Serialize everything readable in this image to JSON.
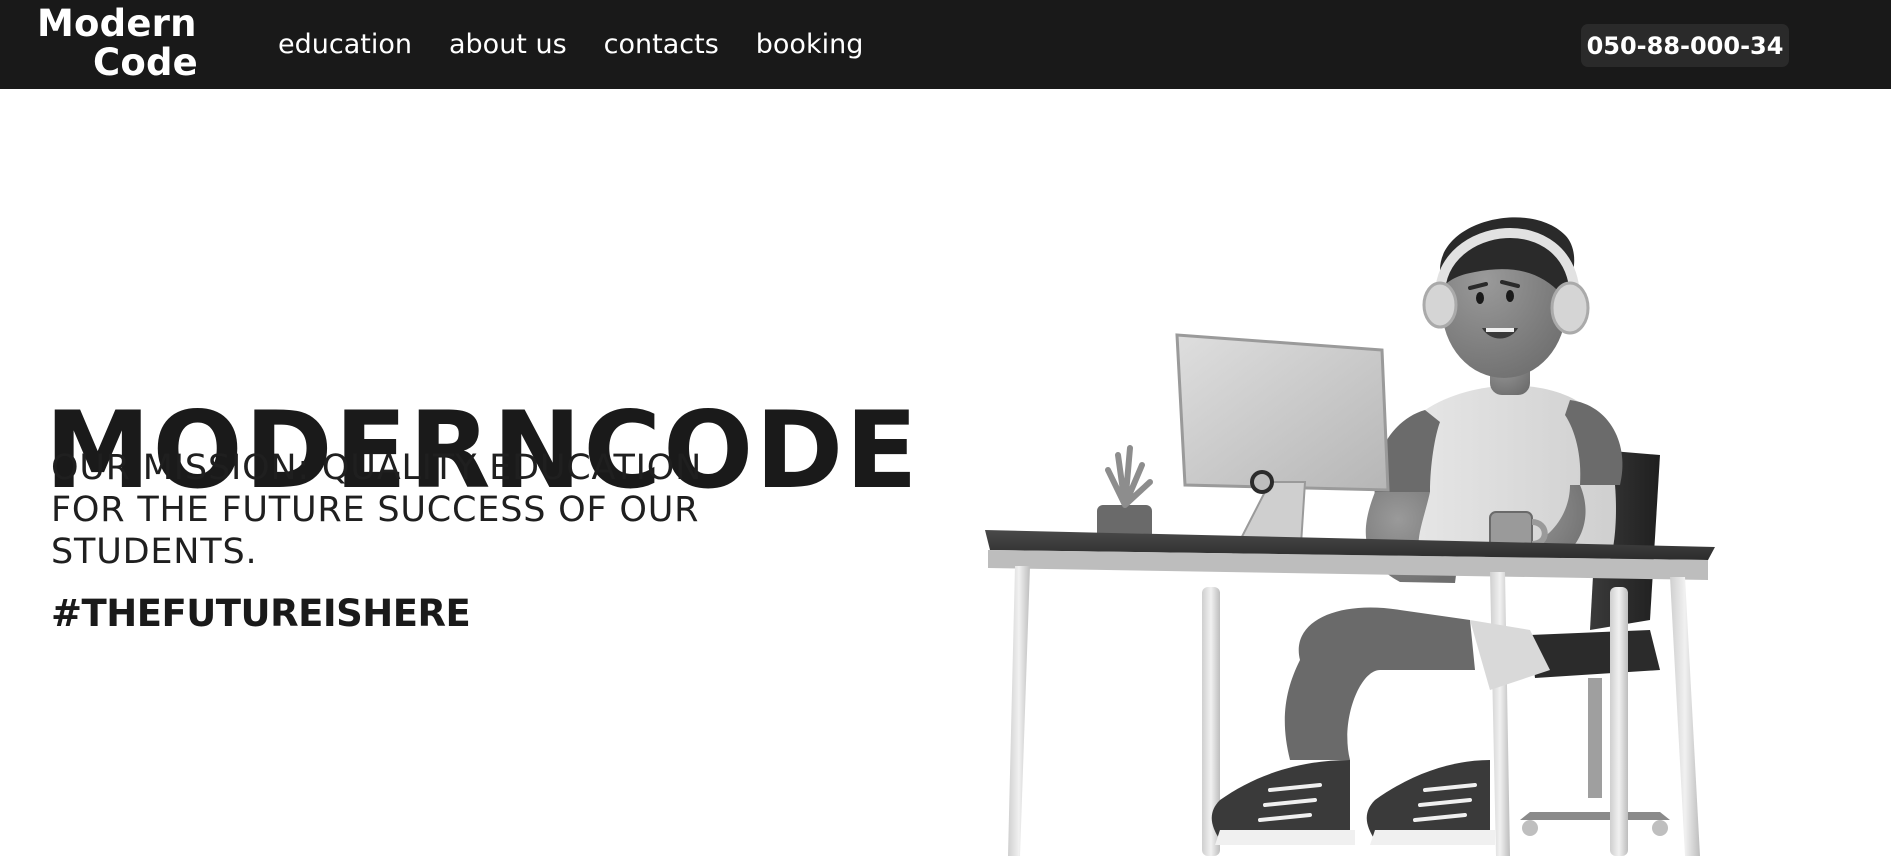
{
  "header": {
    "logo": {
      "line1": "Modern",
      "line2": "Code"
    },
    "nav": [
      {
        "label": "education"
      },
      {
        "label": "about us"
      },
      {
        "label": "contacts"
      },
      {
        "label": "booking"
      }
    ],
    "phone": "050-88-000-34"
  },
  "hero": {
    "title": "MODERNCODE",
    "mission_lines": [
      "OUR MISSION: QUALITY EDUCATION",
      "FOR THE FUTURE SUCCESS OF OUR",
      "STUDENTS."
    ],
    "hashtag": "#THEFUTUREISHERE"
  },
  "colors": {
    "topbar": "#191919",
    "text_dark": "#1a1a1a",
    "white": "#ffffff"
  },
  "icons": {
    "illustration": "person-at-desk-illustration"
  }
}
